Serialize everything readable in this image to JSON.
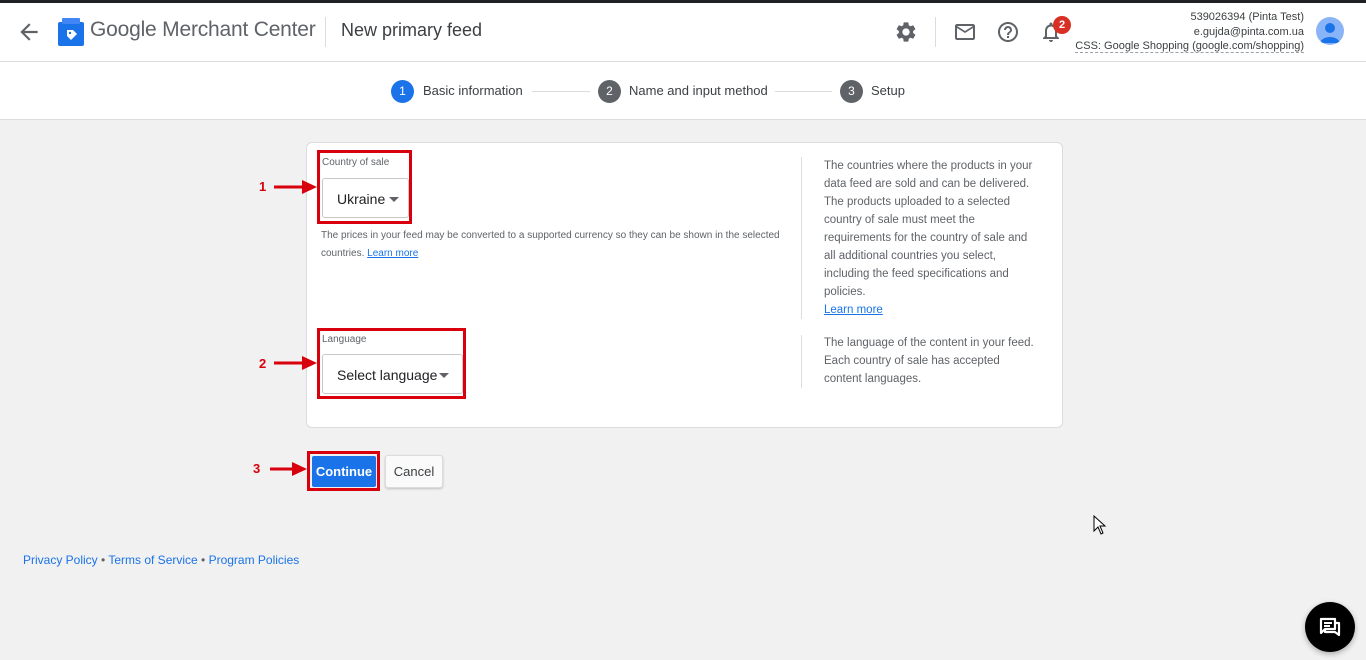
{
  "header": {
    "brand_google": "Google",
    "brand_rest": " Merchant Center",
    "page_title": "New primary feed",
    "notification_count": "2",
    "account_id": "539026394 (Pinta Test)",
    "account_email": "e.gujda@pinta.com.ua",
    "account_css": "CSS: Google Shopping (google.com/shopping)"
  },
  "stepper": {
    "steps": [
      {
        "number": "1",
        "label": "Basic information",
        "active": true
      },
      {
        "number": "2",
        "label": "Name and input method",
        "active": false
      },
      {
        "number": "3",
        "label": "Setup",
        "active": false
      }
    ]
  },
  "form": {
    "country": {
      "label": "Country of sale",
      "value": "Ukraine",
      "hint": "The prices in your feed may be converted to a supported currency so they can be shown in the selected countries.",
      "hint_link": "Learn more",
      "side_text": "The countries where the products in your data feed are sold and can be delivered. The products uploaded to a selected country of sale must meet the requirements for the country of sale and all additional countries you select, including the feed specifications and policies.",
      "side_link": "Learn more"
    },
    "language": {
      "label": "Language",
      "value": "Select language",
      "side_text": "The language of the content in your feed. Each country of sale has accepted content languages."
    }
  },
  "actions": {
    "continue_label": "Continue",
    "cancel_label": "Cancel"
  },
  "annotations": [
    "1",
    "2",
    "3"
  ],
  "footer": {
    "privacy": "Privacy Policy",
    "terms": "Terms of Service",
    "policies": "Program Policies",
    "separator": " • "
  },
  "colors": {
    "accent": "#1a73e8",
    "annotation_red": "#d8000c",
    "badge": "#d93025"
  }
}
